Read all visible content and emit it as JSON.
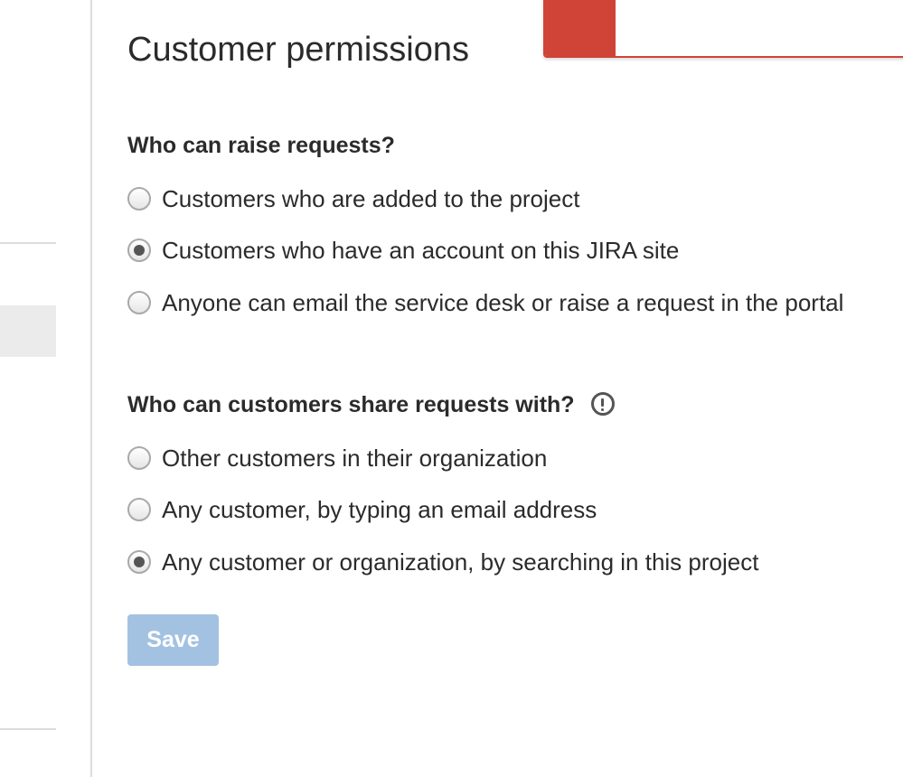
{
  "page": {
    "title": "Customer permissions"
  },
  "sections": [
    {
      "heading": "Who can raise requests?",
      "options": [
        {
          "label": "Customers who are added to the project",
          "checked": false
        },
        {
          "label": "Customers who have an account on this JIRA site",
          "checked": true
        },
        {
          "label": "Anyone can email the service desk or raise a request in the portal",
          "checked": false
        }
      ]
    },
    {
      "heading": "Who can customers share requests with?",
      "icon": "info-icon",
      "options": [
        {
          "label": "Other customers in their organization",
          "checked": false
        },
        {
          "label": "Any customer, by typing an email address",
          "checked": false
        },
        {
          "label": "Any customer or organization, by searching in this project",
          "checked": true
        }
      ]
    }
  ],
  "actions": {
    "save_label": "Save",
    "save_disabled": true
  },
  "colors": {
    "banner_accent": "#d04437",
    "save_disabled_bg": "#a3c2e1",
    "text": "#2b2b2b"
  }
}
